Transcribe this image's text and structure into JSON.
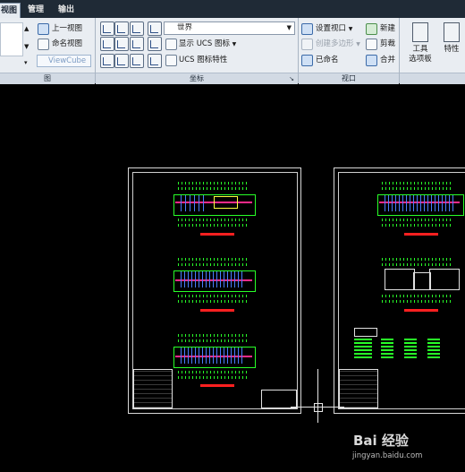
{
  "tabs": [
    {
      "label": "视图",
      "active": true
    },
    {
      "label": "管理",
      "active": false
    },
    {
      "label": "输出",
      "active": false
    }
  ],
  "views_panel": {
    "previous_view": "上一视图",
    "named_views": "命名视图",
    "viewcube": "ViewCube",
    "title": "图"
  },
  "ucs_panel": {
    "ucs_dropdown_value": "世界",
    "show_ucs_icon": "显示 UCS 图标",
    "ucs_icon_properties": "UCS 图标特性",
    "title": "坐标"
  },
  "viewports_panel": {
    "set_viewport": "设置视口",
    "create_polygon": "创建多边形",
    "named": "已命名",
    "new": "新建",
    "clip": "剪裁",
    "join": "合并",
    "title": "视口"
  },
  "tools_panel": {
    "tool_palettes_line1": "工具",
    "tool_palettes_line2": "选项板",
    "properties": "特性"
  },
  "watermark": {
    "logo_text": "Bai 经验",
    "url": "jingyan.baidu.com"
  },
  "colors": {
    "ribbon_bg": "#e9edf2",
    "tab_bar_bg": "#1f2a36",
    "canvas_bg": "#000000",
    "cad_green": "#28ff28",
    "cad_magenta": "#ff2a8a",
    "cad_red": "#ff2020"
  }
}
